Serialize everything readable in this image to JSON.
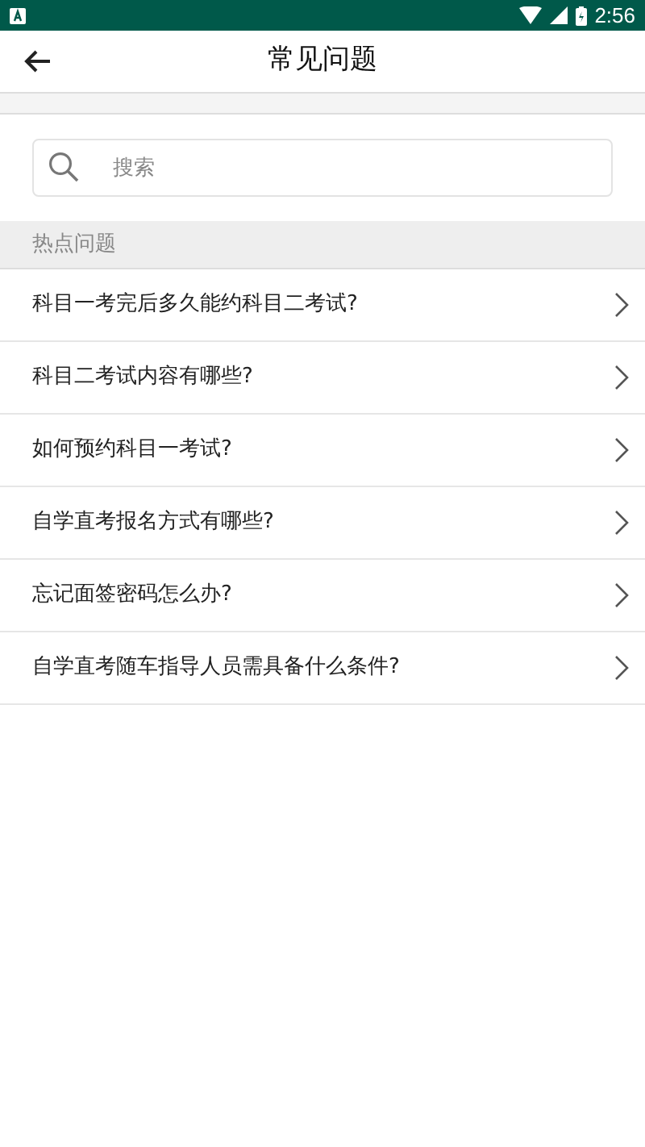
{
  "status_bar": {
    "time": "2:56"
  },
  "toolbar": {
    "title": "常见问题"
  },
  "search": {
    "placeholder": "搜索"
  },
  "section": {
    "title": "热点问题"
  },
  "questions": [
    "科目一考完后多久能约科目二考试?",
    "科目二考试内容有哪些?",
    "如何预约科目一考试?",
    "自学直考报名方式有哪些?",
    "忘记面签密码怎么办?",
    "自学直考随车指导人员需具备什么条件?"
  ]
}
